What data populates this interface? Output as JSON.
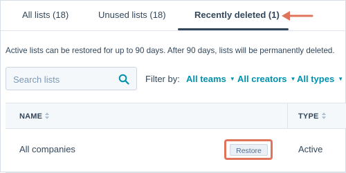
{
  "tabs": [
    {
      "label": "All lists (18)"
    },
    {
      "label": "Unused lists (18)"
    },
    {
      "label": "Recently deleted (1)",
      "active": true
    }
  ],
  "info_text": "Active lists can be restored for up to 90 days. After 90 days, lists will be permanently deleted.",
  "search": {
    "placeholder": "Search lists"
  },
  "filters": {
    "label": "Filter by:",
    "items": [
      {
        "label": "All teams"
      },
      {
        "label": "All creators"
      },
      {
        "label": "All types"
      }
    ]
  },
  "table": {
    "columns": [
      "NAME",
      "TYPE"
    ],
    "rows": [
      {
        "name": "All companies",
        "action": "Restore",
        "type": "Active"
      }
    ]
  },
  "colors": {
    "accent": "#0091ae",
    "text": "#33475b",
    "annotation": "#e0745a"
  },
  "icons": [
    "search-icon",
    "sort-icon",
    "chevron-down-icon",
    "annotation-arrow-icon"
  ]
}
